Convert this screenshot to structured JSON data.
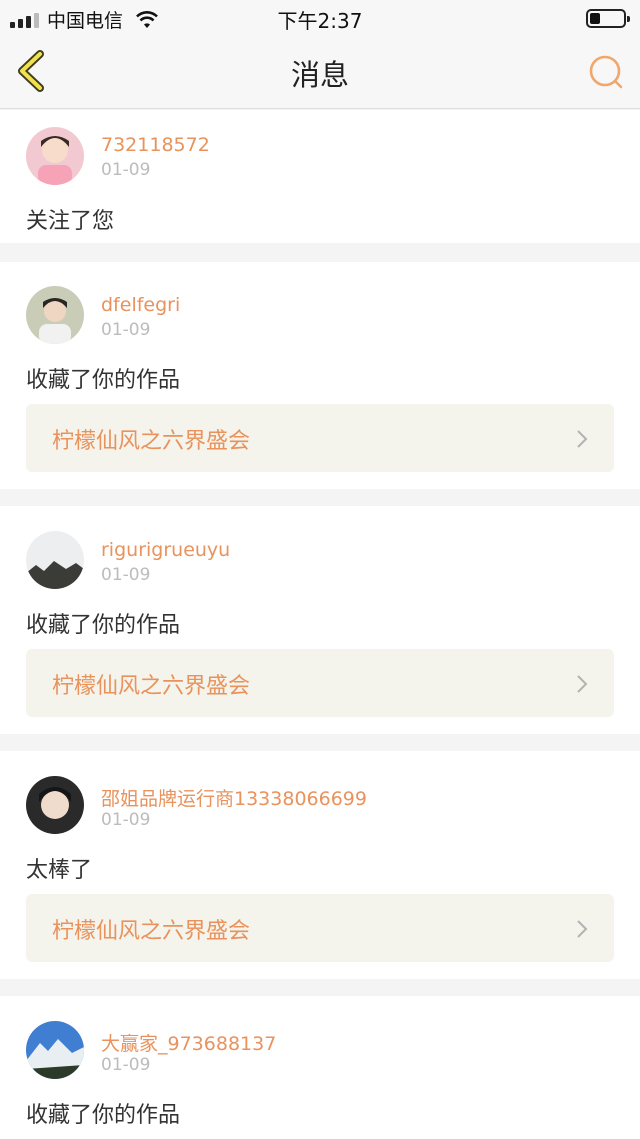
{
  "status_bar": {
    "carrier": "中国电信",
    "time": "下午2:37"
  },
  "nav": {
    "title": "消息"
  },
  "messages": [
    {
      "username": "732118572",
      "date": "01-09",
      "action": "关注了您"
    },
    {
      "username": "dfelfegri",
      "date": "01-09",
      "action": "收藏了你的作品",
      "work_title": "柠檬仙风之六界盛会"
    },
    {
      "username": "rigurigrueuyu",
      "date": "01-09",
      "action": "收藏了你的作品",
      "work_title": "柠檬仙风之六界盛会"
    },
    {
      "username": "邵姐品牌运行商13338066699",
      "date": "01-09",
      "action": "太棒了",
      "work_title": "柠檬仙风之六界盛会"
    },
    {
      "username": "大赢家_973688137",
      "date": "01-09",
      "action": "收藏了你的作品"
    }
  ]
}
